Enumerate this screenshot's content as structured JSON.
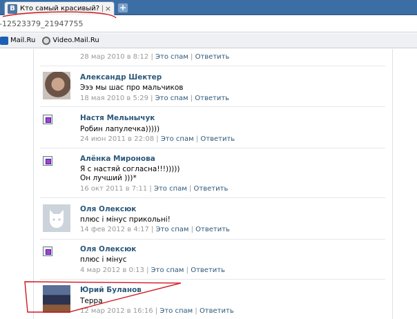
{
  "browser": {
    "tab_title": "Кто самый красивый? | Фан",
    "tab_close": "×",
    "new_tab": "+",
    "favicon_letter": "B",
    "address": "-12523379_21947755",
    "bookmarks": [
      "Mail.Ru",
      "Video.Mail.Ru"
    ]
  },
  "comments_top_meta": {
    "date": "28 мар 2010 в 8:12",
    "spam": "Это спам",
    "reply": "Ответить"
  },
  "comments": [
    {
      "author": "Александр Шектер",
      "lines": [
        "Эээ мы шас про мальчиков"
      ],
      "date": "18 мая 2010 в 5:29",
      "spam": "Это спам",
      "reply": "Ответить",
      "avatar": "photo-a"
    },
    {
      "author": "Настя Мельнычук",
      "lines": [
        "Робин лапулечка)))))"
      ],
      "date": "24 июн 2011 в 22:08",
      "spam": "Это спам",
      "reply": "Ответить",
      "avatar": "broken"
    },
    {
      "author": "Алёнка Миронова",
      "lines": [
        "Я с настяй согласна!!!)))))",
        "Он лучший )))*"
      ],
      "date": "16 окт 2011 в 7:11",
      "spam": "Это спам",
      "reply": "Ответить",
      "avatar": "broken"
    },
    {
      "author": "Оля Олексюк",
      "lines": [
        "плюс і мінус прикольні!"
      ],
      "date": "14 фев 2012 в 4:17",
      "spam": "Это спам",
      "reply": "Ответить",
      "avatar": "dog"
    },
    {
      "author": "Оля Олексюк",
      "lines": [
        "плюс і мінус"
      ],
      "date": "4 мар 2012 в 0:13",
      "spam": "Это спам",
      "reply": "Ответить",
      "avatar": "broken"
    },
    {
      "author": "Юрий Буланов",
      "lines": [
        "Терра"
      ],
      "date": "12 мар 2012 в 16:16",
      "spam": "Это спам",
      "reply": "Ответить",
      "avatar": "photo-b"
    }
  ],
  "separator": "|",
  "colors": {
    "link": "#2b587a",
    "meta": "#999999",
    "annotation": "#d0161f"
  }
}
